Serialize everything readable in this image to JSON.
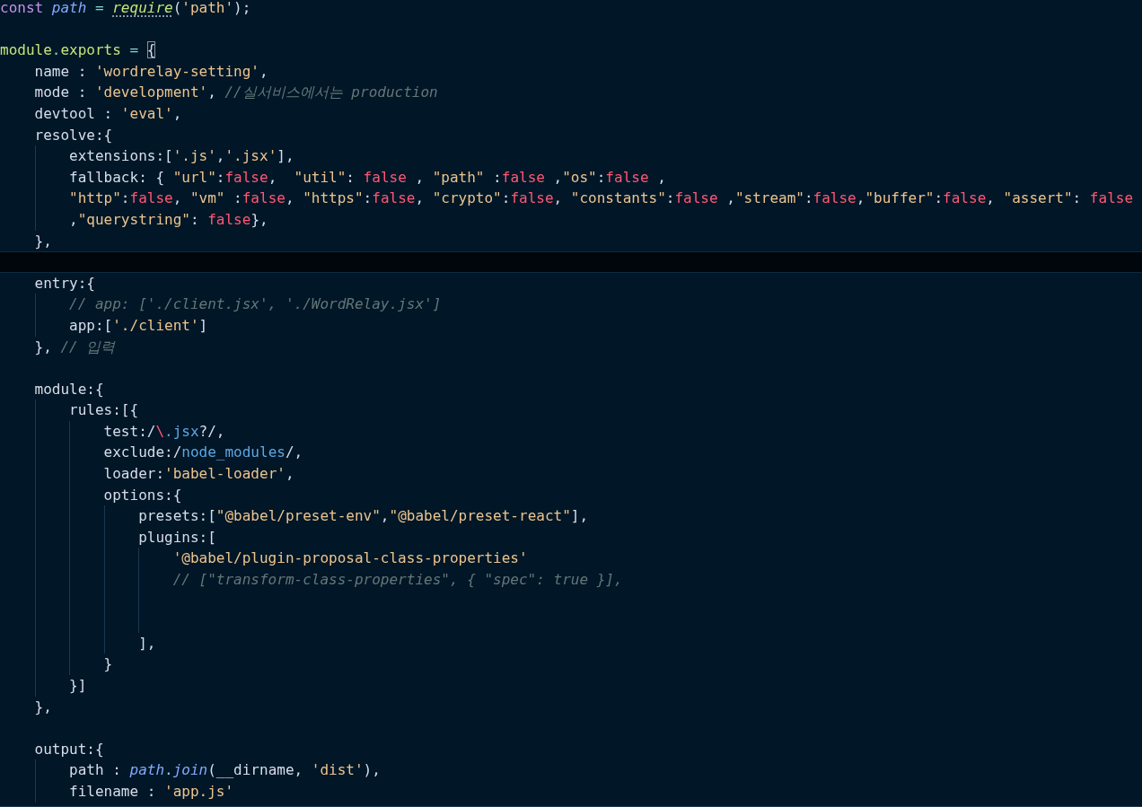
{
  "editor": {
    "lines": [
      {
        "active": false,
        "tokens": [
          {
            "text": "const ",
            "kind": "keyword"
          },
          {
            "text": "path ",
            "kind": "variable"
          },
          {
            "text": "= ",
            "kind": "operator"
          },
          {
            "text": "require",
            "kind": "function",
            "hint": true
          },
          {
            "text": "(",
            "kind": "plain"
          },
          {
            "text": "'path'",
            "kind": "string"
          },
          {
            "text": ");",
            "kind": "plain"
          }
        ]
      },
      {
        "active": false
      },
      {
        "active": false,
        "tokens": [
          {
            "text": "module",
            "kind": "object"
          },
          {
            "text": ".",
            "kind": "operator"
          },
          {
            "text": "exports ",
            "kind": "object"
          },
          {
            "text": "= ",
            "kind": "operator"
          },
          {
            "text": "{",
            "kind": "plain",
            "boxed": true
          }
        ]
      },
      {
        "active": false,
        "tokens": [
          {
            "text": "    name : ",
            "kind": "plain"
          },
          {
            "text": "'wordrelay-setting'",
            "kind": "string"
          },
          {
            "text": ",",
            "kind": "plain"
          }
        ]
      },
      {
        "active": false,
        "tokens": [
          {
            "text": "    mode : ",
            "kind": "plain"
          },
          {
            "text": "'development'",
            "kind": "string"
          },
          {
            "text": ", ",
            "kind": "plain"
          },
          {
            "text": "//실서비스에서는 production",
            "kind": "comment"
          }
        ]
      },
      {
        "active": false,
        "tokens": [
          {
            "text": "    devtool : ",
            "kind": "plain"
          },
          {
            "text": "'eval'",
            "kind": "string"
          },
          {
            "text": ",",
            "kind": "plain"
          }
        ]
      },
      {
        "active": false,
        "tokens": [
          {
            "text": "    resolve:{",
            "kind": "plain"
          }
        ]
      },
      {
        "active": false,
        "tokens": [
          {
            "text": "        extensions:[",
            "kind": "plain"
          },
          {
            "text": "'.js'",
            "kind": "string"
          },
          {
            "text": ",",
            "kind": "plain"
          },
          {
            "text": "'.jsx'",
            "kind": "string"
          },
          {
            "text": "],",
            "kind": "plain"
          }
        ]
      },
      {
        "active": false,
        "tokens": [
          {
            "text": "        fallback: { ",
            "kind": "plain"
          },
          {
            "text": "\"url\"",
            "kind": "string"
          },
          {
            "text": ":",
            "kind": "plain"
          },
          {
            "text": "false",
            "kind": "boolean"
          },
          {
            "text": ",  ",
            "kind": "plain"
          },
          {
            "text": "\"util\"",
            "kind": "string"
          },
          {
            "text": ": ",
            "kind": "plain"
          },
          {
            "text": "false",
            "kind": "boolean"
          },
          {
            "text": " , ",
            "kind": "plain"
          },
          {
            "text": "\"path\"",
            "kind": "string"
          },
          {
            "text": " :",
            "kind": "plain"
          },
          {
            "text": "false",
            "kind": "boolean"
          },
          {
            "text": " ,",
            "kind": "plain"
          },
          {
            "text": "\"os\"",
            "kind": "string"
          },
          {
            "text": ":",
            "kind": "plain"
          },
          {
            "text": "false",
            "kind": "boolean"
          },
          {
            "text": " ,",
            "kind": "plain"
          }
        ]
      },
      {
        "active": false,
        "tokens": [
          {
            "text": "        \"http\"",
            "kind": "string"
          },
          {
            "text": ":",
            "kind": "plain"
          },
          {
            "text": "false",
            "kind": "boolean"
          },
          {
            "text": ", ",
            "kind": "plain"
          },
          {
            "text": "\"vm\"",
            "kind": "string"
          },
          {
            "text": " :",
            "kind": "plain"
          },
          {
            "text": "false",
            "kind": "boolean"
          },
          {
            "text": ", ",
            "kind": "plain"
          },
          {
            "text": "\"https\"",
            "kind": "string"
          },
          {
            "text": ":",
            "kind": "plain"
          },
          {
            "text": "false",
            "kind": "boolean"
          },
          {
            "text": ", ",
            "kind": "plain"
          },
          {
            "text": "\"crypto\"",
            "kind": "string"
          },
          {
            "text": ":",
            "kind": "plain"
          },
          {
            "text": "false",
            "kind": "boolean"
          },
          {
            "text": ", ",
            "kind": "plain"
          },
          {
            "text": "\"constants\"",
            "kind": "string"
          },
          {
            "text": ":",
            "kind": "plain"
          },
          {
            "text": "false",
            "kind": "boolean"
          },
          {
            "text": " ,",
            "kind": "plain"
          },
          {
            "text": "\"stream\"",
            "kind": "string"
          },
          {
            "text": ":",
            "kind": "plain"
          },
          {
            "text": "false",
            "kind": "boolean"
          },
          {
            "text": ",",
            "kind": "plain"
          },
          {
            "text": "\"buffer\"",
            "kind": "string"
          },
          {
            "text": ":",
            "kind": "plain"
          },
          {
            "text": "false",
            "kind": "boolean"
          },
          {
            "text": ", ",
            "kind": "plain"
          },
          {
            "text": "\"assert\"",
            "kind": "string"
          },
          {
            "text": ": ",
            "kind": "plain"
          },
          {
            "text": "false",
            "kind": "boolean"
          }
        ]
      },
      {
        "active": false,
        "tokens": [
          {
            "text": "        ,",
            "kind": "plain"
          },
          {
            "text": "\"querystring\"",
            "kind": "string"
          },
          {
            "text": ": ",
            "kind": "plain"
          },
          {
            "text": "false",
            "kind": "boolean"
          },
          {
            "text": "},",
            "kind": "plain"
          }
        ]
      },
      {
        "active": false,
        "tokens": [
          {
            "text": "    },",
            "kind": "plain"
          }
        ]
      },
      {
        "active": true
      },
      {
        "active": false,
        "tokens": [
          {
            "text": "    entry:{",
            "kind": "plain"
          }
        ]
      },
      {
        "active": false,
        "tokens": [
          {
            "text": "        // app: ['./client.jsx', './WordRelay.jsx']",
            "kind": "comment"
          }
        ]
      },
      {
        "active": false,
        "tokens": [
          {
            "text": "        app:[",
            "kind": "plain"
          },
          {
            "text": "'./client'",
            "kind": "string"
          },
          {
            "text": "]",
            "kind": "plain"
          }
        ]
      },
      {
        "active": false,
        "tokens": [
          {
            "text": "    }, ",
            "kind": "plain"
          },
          {
            "text": "// 입력",
            "kind": "comment"
          }
        ]
      },
      {
        "active": false
      },
      {
        "active": false,
        "tokens": [
          {
            "text": "    module:{",
            "kind": "plain"
          }
        ]
      },
      {
        "active": false,
        "tokens": [
          {
            "text": "        rules:[{",
            "kind": "plain"
          }
        ]
      },
      {
        "active": false,
        "tokens": [
          {
            "text": "            test:/",
            "kind": "plain"
          },
          {
            "text": "\\",
            "kind": "escape"
          },
          {
            "text": ".jsx",
            "kind": "regex"
          },
          {
            "text": "?/,",
            "kind": "plain"
          }
        ]
      },
      {
        "active": false,
        "tokens": [
          {
            "text": "            exclude:/",
            "kind": "plain"
          },
          {
            "text": "node_modules",
            "kind": "regex"
          },
          {
            "text": "/,",
            "kind": "plain"
          }
        ]
      },
      {
        "active": false,
        "tokens": [
          {
            "text": "            loader:",
            "kind": "plain"
          },
          {
            "text": "'babel-loader'",
            "kind": "string"
          },
          {
            "text": ",",
            "kind": "plain"
          }
        ]
      },
      {
        "active": false,
        "tokens": [
          {
            "text": "            options:{",
            "kind": "plain"
          }
        ]
      },
      {
        "active": false,
        "tokens": [
          {
            "text": "                presets:[",
            "kind": "plain"
          },
          {
            "text": "\"@babel/preset-env\"",
            "kind": "string"
          },
          {
            "text": ",",
            "kind": "plain"
          },
          {
            "text": "\"@babel/preset-react\"",
            "kind": "string"
          },
          {
            "text": "],",
            "kind": "plain"
          }
        ]
      },
      {
        "active": false,
        "tokens": [
          {
            "text": "                plugins:[",
            "kind": "plain"
          }
        ]
      },
      {
        "active": false,
        "tokens": [
          {
            "text": "                    '@babel/plugin-proposal-class-properties'",
            "kind": "string"
          }
        ]
      },
      {
        "active": false,
        "tokens": [
          {
            "text": "                    // [\"transform-class-properties\", { \"spec\": true }],",
            "kind": "comment"
          }
        ]
      },
      {
        "active": false
      },
      {
        "active": false
      },
      {
        "active": false,
        "tokens": [
          {
            "text": "                ],",
            "kind": "plain"
          }
        ]
      },
      {
        "active": false,
        "tokens": [
          {
            "text": "            }",
            "kind": "plain"
          }
        ]
      },
      {
        "active": false,
        "tokens": [
          {
            "text": "        }]",
            "kind": "plain"
          }
        ]
      },
      {
        "active": false,
        "tokens": [
          {
            "text": "    },",
            "kind": "plain"
          }
        ]
      },
      {
        "active": false
      },
      {
        "active": false,
        "tokens": [
          {
            "text": "    output:{",
            "kind": "plain"
          }
        ]
      },
      {
        "active": false,
        "tokens": [
          {
            "text": "        path : ",
            "kind": "plain"
          },
          {
            "text": "path",
            "kind": "variable"
          },
          {
            "text": ".",
            "kind": "operator"
          },
          {
            "text": "join",
            "kind": "variable"
          },
          {
            "text": "(__dirname, ",
            "kind": "plain"
          },
          {
            "text": "'dist'",
            "kind": "string"
          },
          {
            "text": "),",
            "kind": "plain"
          }
        ]
      },
      {
        "active": false,
        "tokens": [
          {
            "text": "        filename : ",
            "kind": "plain"
          },
          {
            "text": "'app.js'",
            "kind": "string"
          }
        ]
      }
    ]
  }
}
